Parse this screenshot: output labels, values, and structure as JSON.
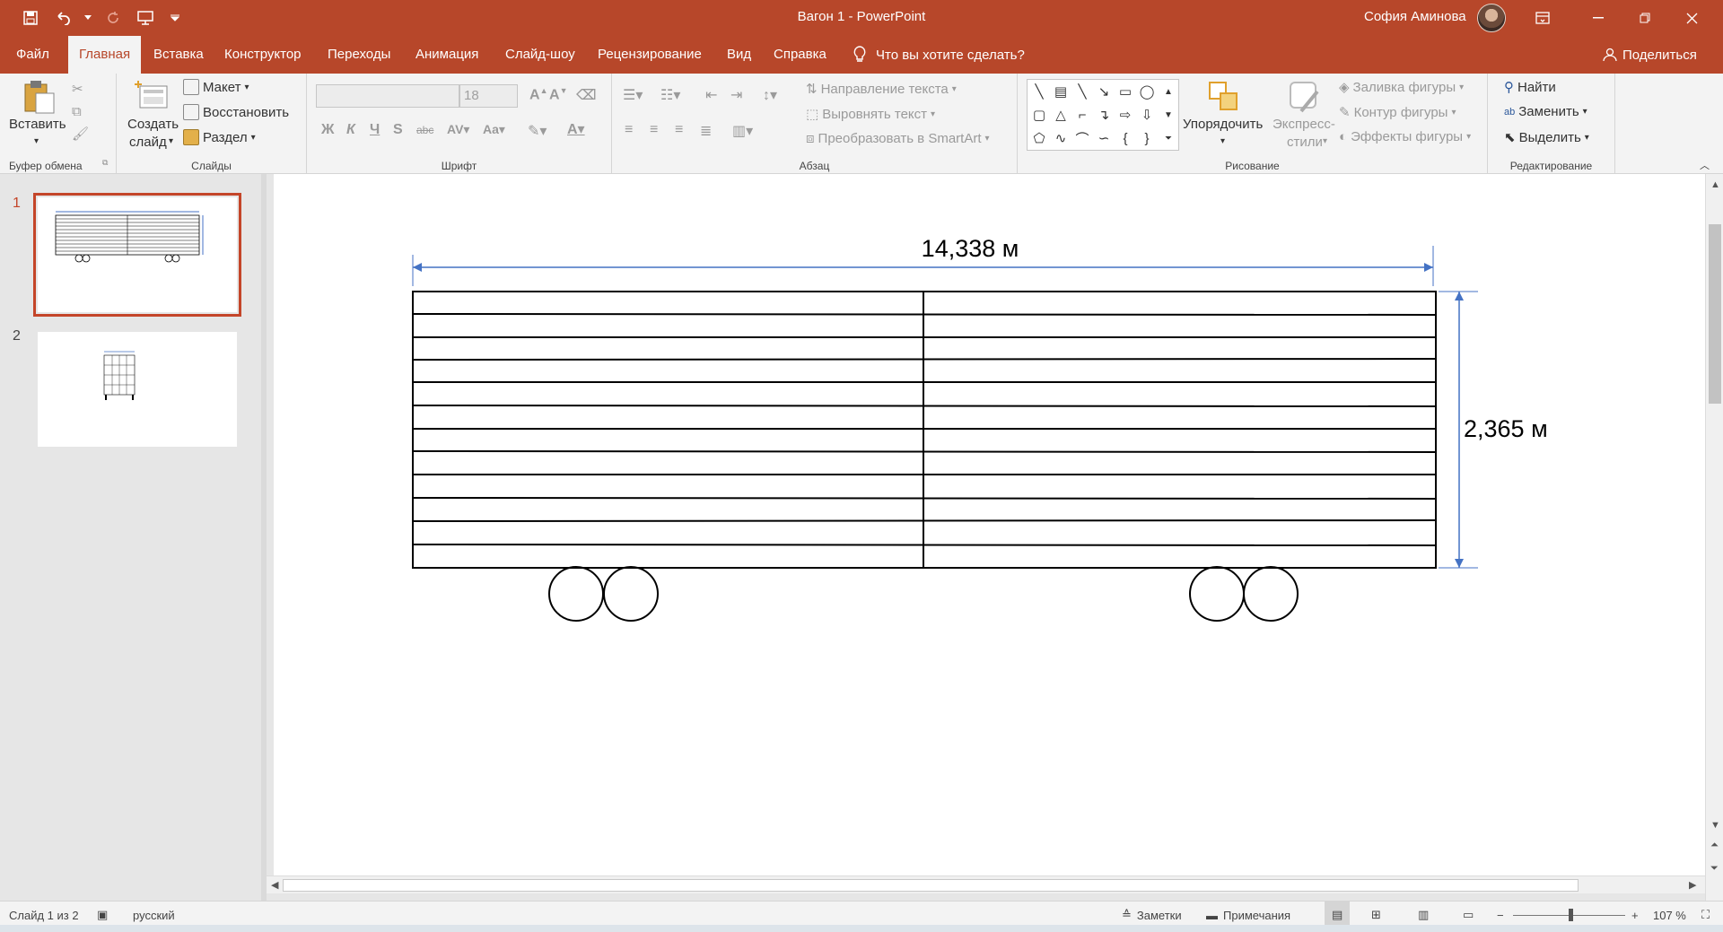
{
  "window": {
    "title": "Вагон 1  -  PowerPoint",
    "user": "София Аминова",
    "accent": "#b7472a"
  },
  "qat": {
    "save_icon": "save-icon",
    "undo_icon": "undo-icon",
    "redo_icon": "redo-icon",
    "present_icon": "present-icon",
    "customize_icon": "chevron-down-icon"
  },
  "tabs": [
    {
      "label": "Файл"
    },
    {
      "label": "Главная"
    },
    {
      "label": "Вставка"
    },
    {
      "label": "Конструктор"
    },
    {
      "label": "Переходы"
    },
    {
      "label": "Анимация"
    },
    {
      "label": "Слайд-шоу"
    },
    {
      "label": "Рецензирование"
    },
    {
      "label": "Вид"
    },
    {
      "label": "Справка"
    }
  ],
  "tellme": "Что вы хотите сделать?",
  "share": "Поделиться",
  "ribbon": {
    "clipboard": {
      "label": "Буфер обмена",
      "paste": "Вставить"
    },
    "slides": {
      "label": "Слайды",
      "new_slide_1": "Создать",
      "new_slide_2": "слайд",
      "layout": "Макет",
      "reset": "Восстановить",
      "section": "Раздел"
    },
    "font": {
      "label": "Шрифт",
      "size": "18"
    },
    "paragraph": {
      "label": "Абзац",
      "text_direction": "Направление текста",
      "align_text": "Выровнять текст",
      "smartart": "Преобразовать в SmartArt"
    },
    "drawing": {
      "label": "Рисование",
      "arrange": "Упорядочить",
      "quick_styles_1": "Экспресс-",
      "quick_styles_2": "стили",
      "shape_fill": "Заливка фигуры",
      "shape_outline": "Контур фигуры",
      "shape_effects": "Эффекты фигуры"
    },
    "editing": {
      "label": "Редактирование",
      "find": "Найти",
      "replace": "Заменить",
      "select": "Выделить"
    }
  },
  "slides_pane": {
    "numbers": [
      "1",
      "2"
    ]
  },
  "slide": {
    "width_label": "14,338 м",
    "height_label": "2,365 м"
  },
  "statusbar": {
    "slide_info": "Слайд 1 из 2",
    "language": "русский",
    "notes": "Заметки",
    "comments": "Примечания",
    "zoom": "107 %"
  }
}
